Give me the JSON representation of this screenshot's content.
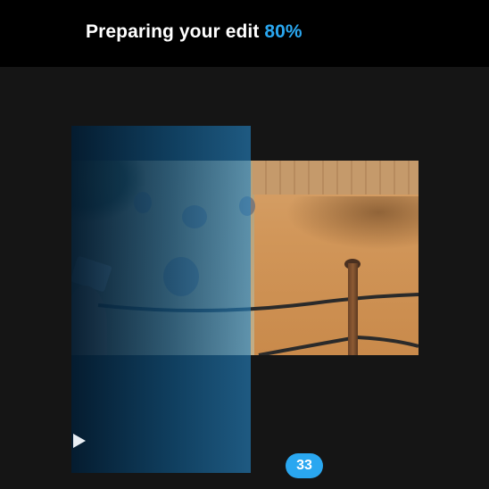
{
  "header": {
    "title": "Preparing your edit",
    "progress_label": "80%",
    "progress": 0.8
  },
  "player": {
    "play_icon": "play-icon"
  },
  "badge": {
    "count": "33"
  },
  "colors": {
    "accent": "#2aa7f0",
    "background": "#151515",
    "header_background": "#000000"
  }
}
